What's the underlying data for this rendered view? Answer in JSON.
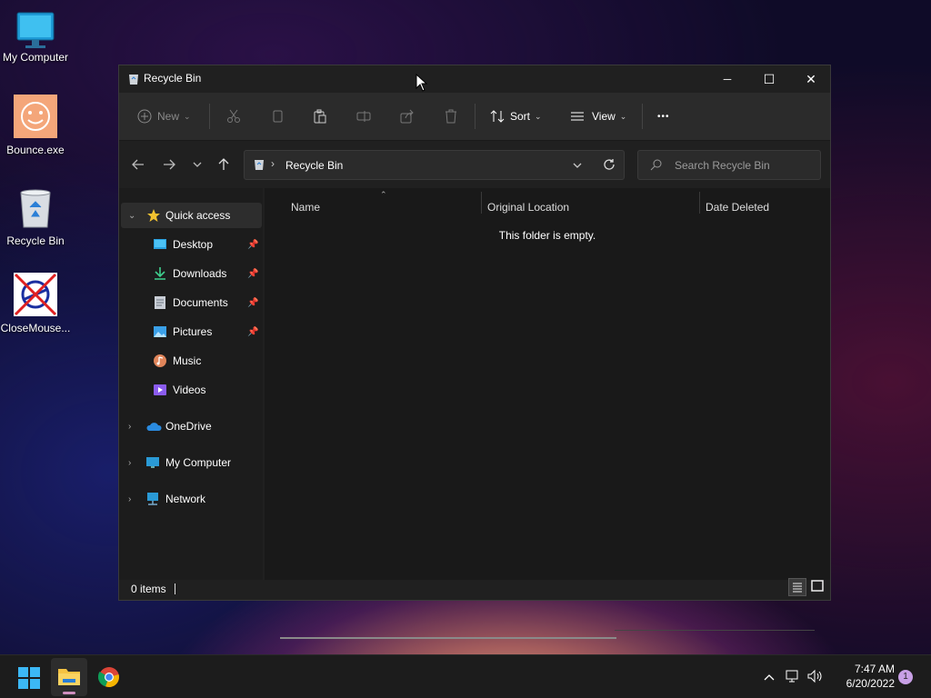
{
  "desktop": {
    "icons": [
      {
        "label": "My Computer",
        "icon": "monitor-icon"
      },
      {
        "label": "Bounce.exe",
        "icon": "smiley-icon"
      },
      {
        "label": "Recycle Bin",
        "icon": "recycle-bin-icon"
      },
      {
        "label": "CloseMouse...",
        "icon": "crossed-out-icon"
      }
    ]
  },
  "window": {
    "title": "Recycle Bin",
    "controls": {
      "minimize": "─",
      "maximize": "☐",
      "close": "✕"
    },
    "toolbar": {
      "new_label": "New",
      "sort_label": "Sort",
      "view_label": "View",
      "more_label": "•••"
    },
    "address": {
      "path": "Recycle Bin",
      "separator": "›"
    },
    "search": {
      "placeholder": "Search Recycle Bin"
    },
    "sidebar": {
      "quick_access": "Quick access",
      "items": [
        {
          "label": "Desktop",
          "pinned": true
        },
        {
          "label": "Downloads",
          "pinned": true
        },
        {
          "label": "Documents",
          "pinned": true
        },
        {
          "label": "Pictures",
          "pinned": true
        },
        {
          "label": "Music",
          "pinned": false
        },
        {
          "label": "Videos",
          "pinned": false
        }
      ],
      "roots": [
        {
          "label": "OneDrive"
        },
        {
          "label": "My Computer"
        },
        {
          "label": "Network"
        }
      ]
    },
    "columns": [
      "Name",
      "Original Location",
      "Date Deleted"
    ],
    "empty_message": "This folder is empty.",
    "status": {
      "items": "0 items"
    }
  },
  "taskbar": {
    "time": "7:47 AM",
    "date": "6/20/2022",
    "notification_count": "1"
  },
  "colors": {
    "accent": "#60cdff",
    "window_bg": "#202020",
    "content_bg": "#191919",
    "taskbar_bg": "#1c1c1c"
  }
}
